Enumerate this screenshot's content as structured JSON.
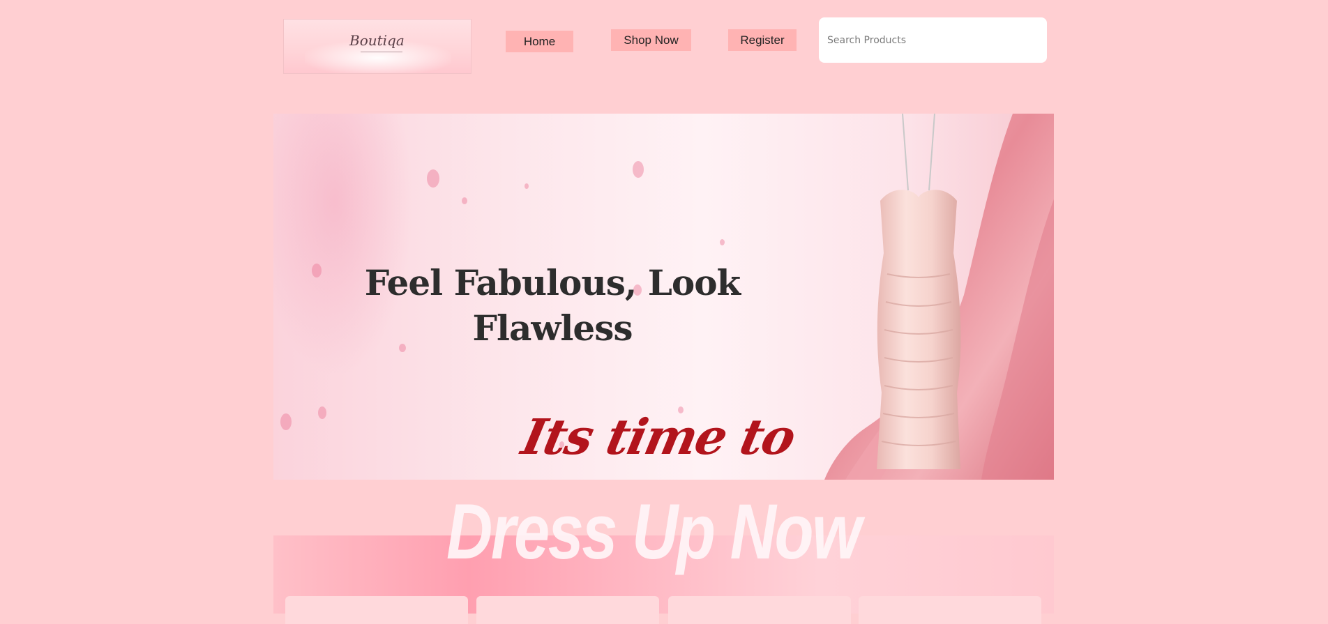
{
  "logo": {
    "text": "Boutiqa"
  },
  "nav": {
    "home_label": "Home",
    "shop_label": "Shop Now",
    "register_label": "Register"
  },
  "search": {
    "placeholder": "Search Products",
    "value": ""
  },
  "hero": {
    "title_line1": "Feel Fabulous, Look",
    "title_line2": "Flawless",
    "tagline": "Its time to",
    "headline": "Dress Up Now"
  },
  "colors": {
    "page_background": "#ffcfd2",
    "nav_button": "#ffb3b3",
    "tagline": "#b2141c",
    "title_text": "#2d2d2d"
  },
  "icons": [
    "logo-image",
    "dress-image"
  ]
}
